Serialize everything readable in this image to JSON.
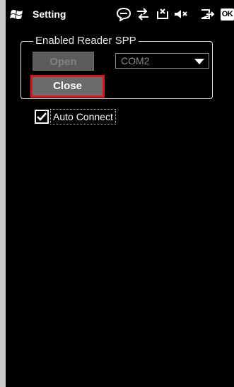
{
  "titlebar": {
    "title": "Setting",
    "ok_label": "OK"
  },
  "groupbox": {
    "legend": "Enabled Reader SPP",
    "open_label": "Open",
    "close_label": "Close",
    "combo_value": "COM2"
  },
  "auto_connect": {
    "label": "Auto Connect",
    "checked": true
  },
  "colors": {
    "screen_bg": "#000000",
    "highlight_border": "#d71920"
  }
}
